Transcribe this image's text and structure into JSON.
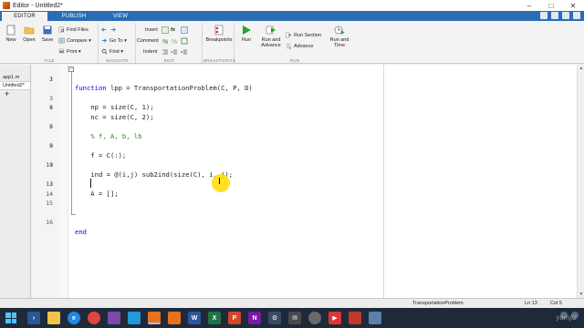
{
  "window": {
    "title": "Editor - Untitled2*",
    "controls": {
      "minimize": "–",
      "maximize": "□",
      "close": "✕"
    }
  },
  "toolstrip": {
    "tabs": [
      {
        "label": "EDITOR",
        "active": true
      },
      {
        "label": "PUBLISH",
        "active": false
      },
      {
        "label": "VIEW",
        "active": false
      }
    ]
  },
  "ribbon": {
    "file": {
      "label": "FILE",
      "new": "New",
      "open": "Open",
      "save": "Save",
      "find_files": "Find Files",
      "compare": "Compare ▾",
      "print": "Print ▾"
    },
    "navigate": {
      "label": "NAVIGATE",
      "go_to": "Go To ▾",
      "find": "Find ▾"
    },
    "edit": {
      "label": "EDIT",
      "insert": "Insert",
      "comment": "Comment",
      "indent": "Indent",
      "fx": "fx"
    },
    "breakpoints": {
      "label": "BREAKPOINTS",
      "breakpoints": "Breakpoints"
    },
    "run": {
      "label": "RUN",
      "run": "Run",
      "run_and_advance": "Run and Advance",
      "run_section": "Run Section",
      "advance": "Advance",
      "run_and_time": "Run and Time"
    }
  },
  "files": {
    "tabs": [
      {
        "label": "app1.m",
        "active": false
      },
      {
        "label": "Untitled2*",
        "active": true
      }
    ],
    "add": "+"
  },
  "editor": {
    "lines": [
      {
        "n": "1",
        "kw": "function ",
        "code": "lpp = TransportationProblem(C, P, D)",
        "cm": ""
      },
      {
        "n": "2",
        "kw": "",
        "code": "",
        "cm": ""
      },
      {
        "n": "3",
        "kw": "",
        "code": "    np = size(C, 1);",
        "cm": ""
      },
      {
        "n": "4",
        "kw": "",
        "code": "    nc = size(C, 2);",
        "cm": ""
      },
      {
        "n": "5",
        "kw": "",
        "code": "",
        "cm": ""
      },
      {
        "n": "6",
        "kw": "",
        "code": "",
        "cm": "    % f, A, b, lb"
      },
      {
        "n": "7",
        "kw": "",
        "code": "",
        "cm": ""
      },
      {
        "n": "8",
        "kw": "",
        "code": "    f = C(:);",
        "cm": ""
      },
      {
        "n": "9",
        "kw": "",
        "code": "",
        "cm": ""
      },
      {
        "n": "10",
        "kw": "",
        "code": "    ind = @(i,j) sub2ind(size(C), i, j);",
        "cm": ""
      },
      {
        "n": "11",
        "kw": "",
        "code": "",
        "cm": ""
      },
      {
        "n": "12",
        "kw": "",
        "code": "    A = [];",
        "cm": ""
      },
      {
        "n": "13",
        "kw": "",
        "code": "",
        "cm": ""
      },
      {
        "n": "14",
        "kw": "",
        "code": "",
        "cm": ""
      },
      {
        "n": "15",
        "kw": "",
        "code": "",
        "cm": ""
      },
      {
        "n": "16",
        "kw": "end",
        "code": "",
        "cm": ""
      }
    ],
    "mouse_cursor": "I"
  },
  "statusbar": {
    "function": "TransportationProblem",
    "ln": "Ln   13",
    "col": "Col  5"
  },
  "taskbar": {
    "watermark": "yamjiz"
  }
}
